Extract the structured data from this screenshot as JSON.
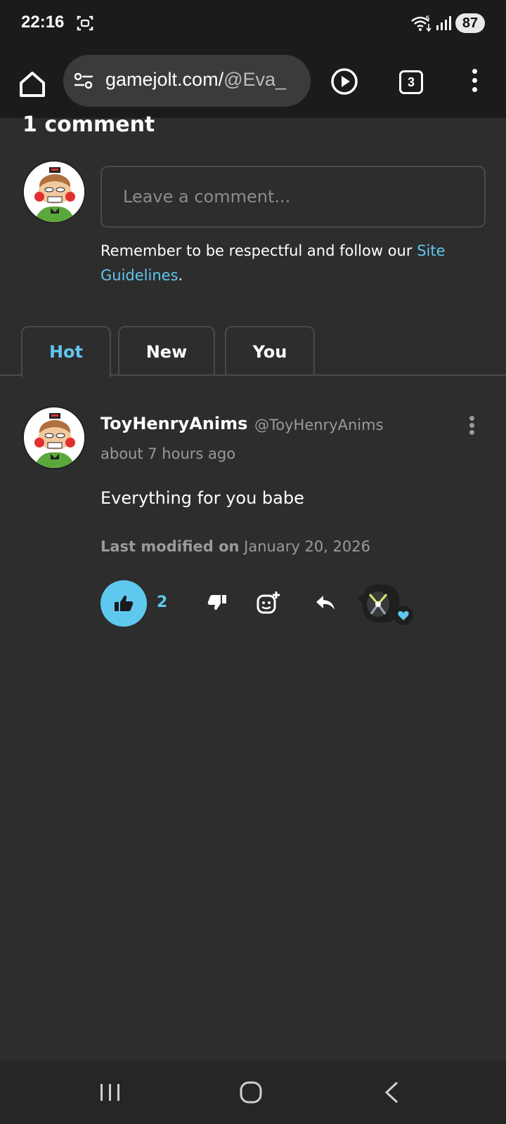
{
  "status_bar": {
    "time": "22:16",
    "battery": "87"
  },
  "browser": {
    "url_main": "gamejolt.com/",
    "url_rest": "@Eva_",
    "tab_count": "3"
  },
  "comments": {
    "count_label": "1 comment",
    "input_placeholder": "Leave a comment...",
    "guidelines_prefix": "Remember to be respectful and follow our ",
    "guidelines_link": "Site Guidelines",
    "guidelines_suffix": "."
  },
  "sort_tabs": [
    {
      "label": "Hot",
      "active": true
    },
    {
      "label": "New",
      "active": false
    },
    {
      "label": "You",
      "active": false
    }
  ],
  "comment": {
    "display_name": "ToyHenryAnims",
    "handle": "@ToyHenryAnims",
    "time_ago": "about 7 hours ago",
    "body": "Everything for you babe",
    "modified_label": "Last modified on",
    "modified_date": "January 20, 2026",
    "like_count": "2"
  },
  "colors": {
    "accent": "#5fc8ef",
    "background": "#2d2d2d",
    "bar": "#1b1b1b"
  },
  "icons": {
    "home": "home-icon",
    "site_settings": "tune-icon",
    "play": "play-icon",
    "menu": "more-vert-icon",
    "like": "thumbs-up-icon",
    "dislike": "thumbs-down-icon",
    "reaction": "add-sticker-icon",
    "reply": "reply-icon"
  }
}
